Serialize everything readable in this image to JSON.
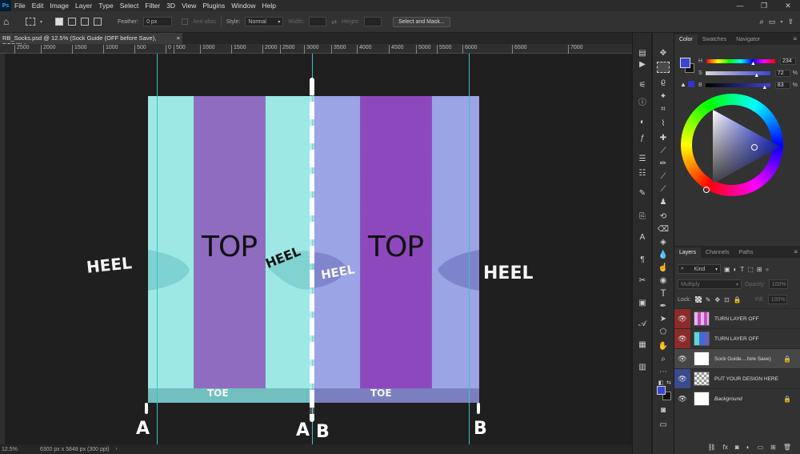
{
  "menubar": {
    "logo": "Ps",
    "items": [
      "File",
      "Edit",
      "Image",
      "Layer",
      "Type",
      "Select",
      "Filter",
      "3D",
      "View",
      "Plugins",
      "Window",
      "Help"
    ],
    "window_buttons": [
      "—",
      "❐",
      "✕"
    ]
  },
  "options_bar": {
    "feather_label": "Feather:",
    "feather_value": "0 px",
    "antialias_label": "Anti-alias",
    "style_label": "Style:",
    "style_value": "Normal",
    "width_label": "Width:",
    "height_label": "Height:",
    "select_mask_label": "Select and Mask..."
  },
  "document_tab": {
    "title": "RB_Socks.psd @ 12.5% (Sock Guide (OFF before Save), RGB/8) *",
    "close": "×"
  },
  "ruler": {
    "ticks": [
      "2500",
      "2000",
      "1500",
      "1000",
      "500",
      "0",
      "500",
      "1000",
      "1500",
      "2000",
      "2500",
      "3000",
      "3500",
      "4000",
      "4500",
      "5000",
      "5500",
      "6000",
      "6500",
      "7000"
    ]
  },
  "canvas": {
    "top_left": "TOP",
    "top_right": "TOP",
    "heel_labels": [
      "HEEL",
      "HEEL",
      "HEEL",
      "HEEL"
    ],
    "toe_labels": [
      "TOE",
      "TOE"
    ],
    "markers": [
      "A",
      "A",
      "B",
      "B"
    ],
    "colors": {
      "turquoise": "#9de8e4",
      "purple_light": "#8f6cc0",
      "purple_dark": "#8e48bd",
      "lavender": "#9ba4e4",
      "guide": "#39c0c8"
    }
  },
  "status_bar": {
    "zoom": "12.5%",
    "doc_info": "6300 px x 5848 px (300 ppi)"
  },
  "color_panel": {
    "tabs": [
      "Color",
      "Swatches",
      "Navigator"
    ],
    "h_label": "H",
    "h_value": "234",
    "s_label": "S",
    "s_value": "72",
    "b_label": "B",
    "b_value": "83",
    "pct": "%",
    "foreground_color": "#3b45d3"
  },
  "layers_panel": {
    "tabs": [
      "Layers",
      "Channels",
      "Paths"
    ],
    "kind_label": "Kind",
    "blend_mode": "Multiply",
    "opacity_label": "Opacity:",
    "opacity_value": "100%",
    "lock_label": "Lock:",
    "fill_label": "Fill:",
    "fill_value": "100%",
    "layers": [
      {
        "name": "TURN LAYER OFF"
      },
      {
        "name": "TURN LAYER OFF"
      },
      {
        "name": "Sock Guide....fore Save)"
      },
      {
        "name": "PUT YOUR DESIGN HERE"
      },
      {
        "name": "Background"
      }
    ]
  }
}
